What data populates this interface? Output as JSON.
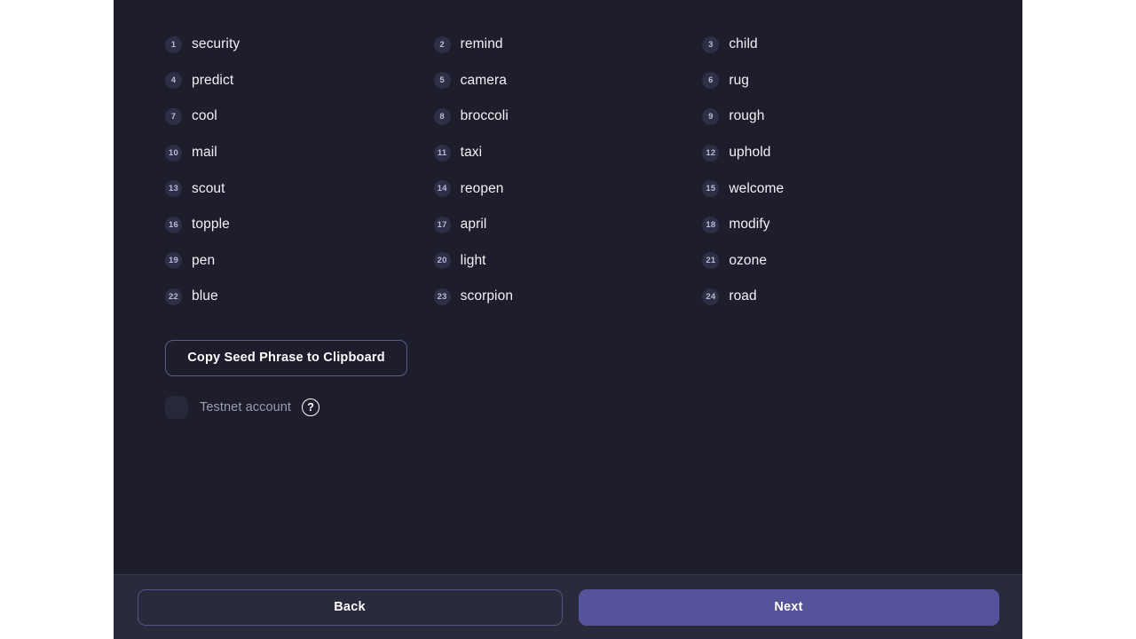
{
  "theme": {
    "panel_bg": "#1d1d2b",
    "footer_bg": "#292a3b",
    "accent": "#55549a",
    "outline": "#5d5c8e",
    "badge_bg": "#2d2f46",
    "badge_text": "#b9b9d4",
    "word_text": "#f2f2f7",
    "muted_text": "#9b9bb4"
  },
  "seed_phrase": {
    "words": [
      {
        "index": "1",
        "word": "security"
      },
      {
        "index": "2",
        "word": "remind"
      },
      {
        "index": "3",
        "word": "child"
      },
      {
        "index": "4",
        "word": "predict"
      },
      {
        "index": "5",
        "word": "camera"
      },
      {
        "index": "6",
        "word": "rug"
      },
      {
        "index": "7",
        "word": "cool"
      },
      {
        "index": "8",
        "word": "broccoli"
      },
      {
        "index": "9",
        "word": "rough"
      },
      {
        "index": "10",
        "word": "mail"
      },
      {
        "index": "11",
        "word": "taxi"
      },
      {
        "index": "12",
        "word": "uphold"
      },
      {
        "index": "13",
        "word": "scout"
      },
      {
        "index": "14",
        "word": "reopen"
      },
      {
        "index": "15",
        "word": "welcome"
      },
      {
        "index": "16",
        "word": "topple"
      },
      {
        "index": "17",
        "word": "april"
      },
      {
        "index": "18",
        "word": "modify"
      },
      {
        "index": "19",
        "word": "pen"
      },
      {
        "index": "20",
        "word": "light"
      },
      {
        "index": "21",
        "word": "ozone"
      },
      {
        "index": "22",
        "word": "blue"
      },
      {
        "index": "23",
        "word": "scorpion"
      },
      {
        "index": "24",
        "word": "road"
      }
    ]
  },
  "actions": {
    "copy_label": "Copy Seed Phrase to Clipboard"
  },
  "testnet": {
    "label": "Testnet account",
    "checked": false,
    "help_icon": "question-mark-icon",
    "help_glyph": "?"
  },
  "footer": {
    "back_label": "Back",
    "next_label": "Next"
  }
}
